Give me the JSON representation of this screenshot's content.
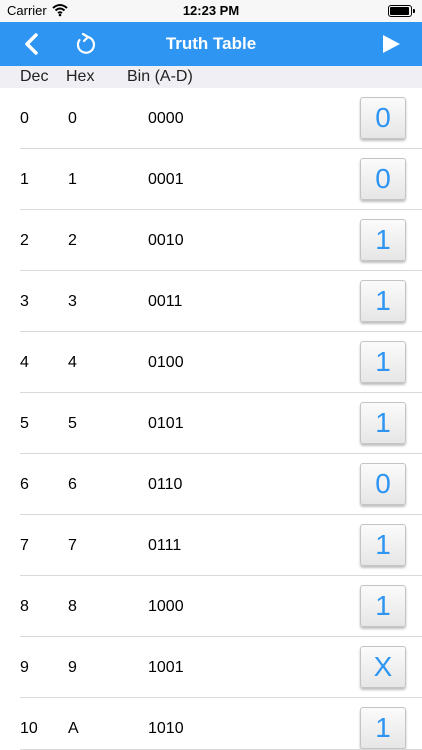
{
  "status_bar": {
    "carrier": "Carrier",
    "time": "12:23 PM"
  },
  "navbar": {
    "title": "Truth Table"
  },
  "header": {
    "dec": "Dec",
    "hex": "Hex",
    "bin": "Bin (A-D)"
  },
  "rows": [
    {
      "dec": "0",
      "hex": "0",
      "bin": "0000",
      "value": "0"
    },
    {
      "dec": "1",
      "hex": "1",
      "bin": "0001",
      "value": "0"
    },
    {
      "dec": "2",
      "hex": "2",
      "bin": "0010",
      "value": "1"
    },
    {
      "dec": "3",
      "hex": "3",
      "bin": "0011",
      "value": "1"
    },
    {
      "dec": "4",
      "hex": "4",
      "bin": "0100",
      "value": "1"
    },
    {
      "dec": "5",
      "hex": "5",
      "bin": "0101",
      "value": "1"
    },
    {
      "dec": "6",
      "hex": "6",
      "bin": "0110",
      "value": "0"
    },
    {
      "dec": "7",
      "hex": "7",
      "bin": "0111",
      "value": "1"
    },
    {
      "dec": "8",
      "hex": "8",
      "bin": "1000",
      "value": "1"
    },
    {
      "dec": "9",
      "hex": "9",
      "bin": "1001",
      "value": "X"
    },
    {
      "dec": "10",
      "hex": "A",
      "bin": "1010",
      "value": "1"
    }
  ],
  "colors": {
    "accent": "#2e95f2",
    "header_bg": "#efeff4"
  },
  "icons": {
    "back": "chevron-left-icon",
    "refresh": "refresh-icon",
    "play": "play-icon"
  }
}
